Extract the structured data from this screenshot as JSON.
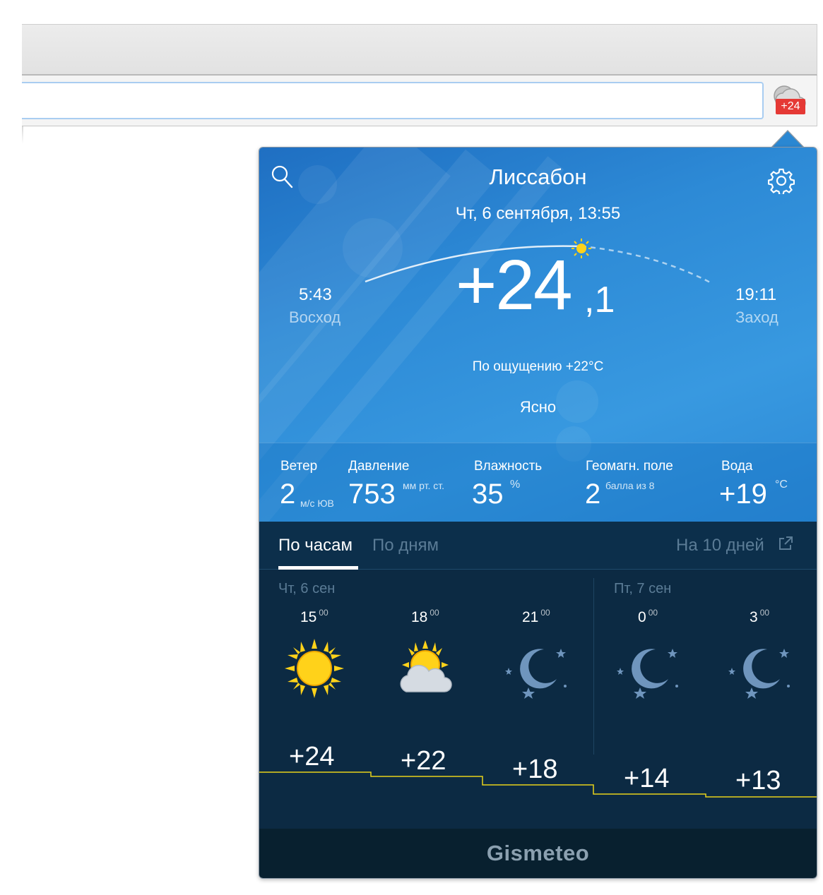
{
  "extension": {
    "badge": "+24"
  },
  "popup": {
    "city": "Лиссабон",
    "datetime": "Чт, 6 сентября, 13:55",
    "sunrise": {
      "time": "5:43",
      "label": "Восход"
    },
    "sunset": {
      "time": "19:11",
      "label": "Заход"
    },
    "temperature": {
      "main": "+24",
      "fraction": ",1"
    },
    "feels_like": "По ощущению +22°C",
    "condition": "Ясно",
    "stats": {
      "wind": {
        "label": "Ветер",
        "value": "2",
        "unit": "м/с ЮВ"
      },
      "pressure": {
        "label": "Давление",
        "value": "753",
        "unit": "мм рт. ст."
      },
      "humidity": {
        "label": "Влажность",
        "value": "35",
        "unit": "%"
      },
      "geomag": {
        "label": "Геомагн. поле",
        "value": "2",
        "unit": "балла из 8"
      },
      "water": {
        "label": "Вода",
        "value": "+19",
        "unit": "°C"
      }
    },
    "tabs": {
      "hourly": "По часам",
      "daily": "По дням",
      "ten_days": "На 10 дней"
    },
    "days": [
      "Чт, 6 сен",
      "Пт, 7 сен"
    ],
    "hours": [
      {
        "hour": "15",
        "min": "00",
        "icon": "sun-icon",
        "temp": "+24"
      },
      {
        "hour": "18",
        "min": "00",
        "icon": "sun-cloud-icon",
        "temp": "+22"
      },
      {
        "hour": "21",
        "min": "00",
        "icon": "moon-icon",
        "temp": "+18"
      },
      {
        "hour": "0",
        "min": "00",
        "icon": "moon-icon",
        "temp": "+14"
      },
      {
        "hour": "3",
        "min": "00",
        "icon": "moon-icon",
        "temp": "+13"
      }
    ],
    "brand": "Gismeteo"
  },
  "colors": {
    "sky": "#2d8ad6",
    "forecast_bg": "#0c2a43",
    "temp_line": "#e8d21b",
    "badge": "#e53935"
  }
}
